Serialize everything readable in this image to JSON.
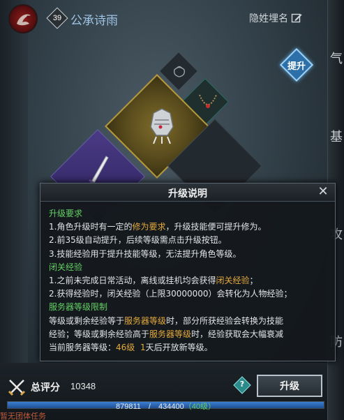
{
  "header": {
    "level": "39",
    "player_name": "公承诗雨",
    "hide_name_label": "隐姓埋名"
  },
  "side_chars": [
    "气",
    "基",
    "攻",
    "防"
  ],
  "lift_button_label": "提升",
  "tooltip": {
    "title": "升级说明",
    "section1_title": "升级要求",
    "line1_pre": "1.角色升级时有一定的",
    "line1_hl": "修为要求",
    "line1_post": "，升级技能便可提升修为。",
    "line2": "2.前35级自动提升，后续等级需点击升级按钮。",
    "line3": "3.技能经验用于提升技能等级，无法提升角色等级。",
    "section2_title": "闭关经验",
    "line4_pre": "1.之前未完成日常活动，离线或挂机均会获得",
    "line4_hl": "闭关经验",
    "line4_post": "；",
    "line5": "2.获得经验时，闭关经验（上限30000000）会转化为人物经验；",
    "section3_title": "服务器等级限制",
    "line6_pre": "等级或剩余经验等于",
    "line6_hl": "服务器等级",
    "line6_post": "时，部分所获经验会转换为技能",
    "line7_pre": "经验；等级或剩余经验高于",
    "line7_hl": "服务器等级",
    "line7_post": "时，经验获取会大幅衰减",
    "line8_pre": "当前服务器等级：",
    "line8_level": "46级",
    "line8_gap": "  ",
    "line8_days": "1",
    "line8_post": "天后开放新等级。"
  },
  "bottom": {
    "score_label": "总评分",
    "score_value": "10348",
    "help_label": "?",
    "upgrade_label": "升级",
    "exp_current": "879811",
    "exp_sep": "/",
    "exp_max": "434400",
    "exp_levels": "（40级）",
    "exp_fill_fraction": 1.0,
    "cut_text": "暂无团体任务"
  },
  "colors": {
    "section_green": "#62d164",
    "highlight_orange": "#e3a93c",
    "name_blue": "#9fc4e6",
    "exp_bar_blue": "#3b7fd3"
  }
}
